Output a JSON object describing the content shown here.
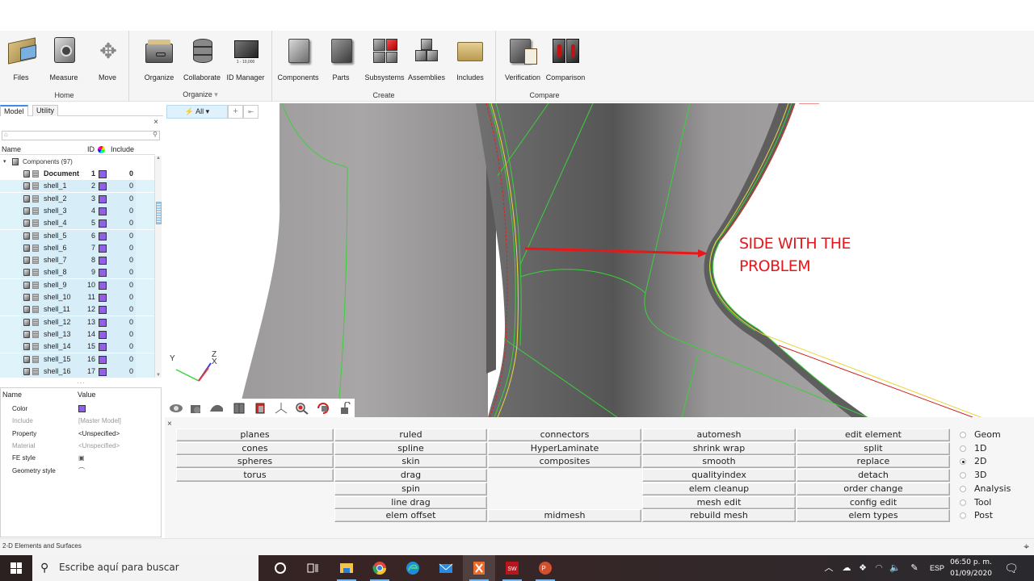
{
  "ribbon": {
    "groups": [
      {
        "title": "Home",
        "buttons": [
          "Files",
          "Measure",
          "Move"
        ]
      },
      {
        "title": "Organize",
        "buttons": [
          "Organize",
          "Collaborate",
          "ID Manager"
        ],
        "dropdown": "▾",
        "id_manager_caption": "1 - 10,000"
      },
      {
        "title": "Create",
        "buttons": [
          "Components",
          "Parts",
          "Subsystems",
          "Assemblies",
          "Includes"
        ]
      },
      {
        "title": "Compare",
        "buttons": [
          "Verification",
          "Comparison"
        ]
      }
    ]
  },
  "browser": {
    "tabs": [
      "Model",
      "Utility"
    ],
    "active_tab": "Model",
    "close": "×",
    "search_placeholder": "",
    "columns": {
      "name": "Name",
      "id": "ID",
      "include": "Include"
    },
    "root": {
      "label": "Components (97)",
      "expanded": true
    },
    "rows": [
      {
        "name": "Document",
        "id": "1",
        "include": "0",
        "bold": true
      },
      {
        "name": "shell_1",
        "id": "2",
        "include": "0"
      },
      {
        "name": "shell_2",
        "id": "3",
        "include": "0"
      },
      {
        "name": "shell_3",
        "id": "4",
        "include": "0"
      },
      {
        "name": "shell_4",
        "id": "5",
        "include": "0"
      },
      {
        "name": "shell_5",
        "id": "6",
        "include": "0"
      },
      {
        "name": "shell_6",
        "id": "7",
        "include": "0"
      },
      {
        "name": "shell_7",
        "id": "8",
        "include": "0"
      },
      {
        "name": "shell_8",
        "id": "9",
        "include": "0"
      },
      {
        "name": "shell_9",
        "id": "10",
        "include": "0"
      },
      {
        "name": "shell_10",
        "id": "11",
        "include": "0"
      },
      {
        "name": "shell_11",
        "id": "12",
        "include": "0"
      },
      {
        "name": "shell_12",
        "id": "13",
        "include": "0"
      },
      {
        "name": "shell_13",
        "id": "14",
        "include": "0"
      },
      {
        "name": "shell_14",
        "id": "15",
        "include": "0"
      },
      {
        "name": "shell_15",
        "id": "16",
        "include": "0"
      },
      {
        "name": "shell_16",
        "id": "17",
        "include": "0"
      }
    ],
    "component_color": "#9060e8"
  },
  "properties": {
    "header": {
      "name": "Name",
      "value": "Value"
    },
    "rows": [
      {
        "key": "Color",
        "value": "",
        "type": "color",
        "dim": false
      },
      {
        "key": "Include",
        "value": "[Master Model]",
        "dim": true
      },
      {
        "key": "Property",
        "value": "<Unspecified>",
        "dim": false
      },
      {
        "key": "Material",
        "value": "<Unspecified>",
        "dim": true
      },
      {
        "key": "FE style",
        "value": "",
        "type": "icon",
        "icon": "fe-style-icon",
        "dim": false
      },
      {
        "key": "Geometry style",
        "value": "",
        "type": "icon",
        "icon": "geometry-style-icon",
        "dim": false
      }
    ]
  },
  "filter": {
    "label": "⚡ All ▾",
    "add": "+",
    "collapse": "⇤"
  },
  "triad": {
    "x": "X",
    "y": "Y",
    "z": "Z"
  },
  "viewport": {
    "annotation_line1": "SIDE WITH THE",
    "annotation_line2": "PROBLEM",
    "annotation_color": "#e8171a"
  },
  "view_tools": [
    "eye-icon",
    "camera-icon",
    "surface-icon",
    "cube-icon",
    "component-icon",
    "triad-icon",
    "zoom-icon",
    "rotate-icon",
    "lock-icon"
  ],
  "panel": {
    "close": "×",
    "columns": [
      [
        "planes",
        "cones",
        "spheres",
        "torus",
        "",
        "",
        ""
      ],
      [
        "ruled",
        "spline",
        "skin",
        "drag",
        "spin",
        "line drag",
        "elem offset"
      ],
      [
        "connectors",
        "HyperLaminate",
        "composites",
        "",
        "",
        "",
        "midmesh"
      ],
      [
        "automesh",
        "shrink wrap",
        "smooth",
        "qualityindex",
        "elem cleanup",
        "mesh edit",
        "rebuild mesh"
      ],
      [
        "edit element",
        "split",
        "replace",
        "detach",
        "order change",
        "config edit",
        "elem types"
      ]
    ],
    "pages": [
      "Geom",
      "1D",
      "2D",
      "3D",
      "Analysis",
      "Tool",
      "Post"
    ],
    "selected_page": "2D"
  },
  "status": {
    "text": "2-D Elements and Surfaces"
  },
  "taskbar": {
    "search_placeholder": "Escribe aquí para buscar",
    "apps": [
      "cortana",
      "task-view",
      "file-explorer",
      "chrome",
      "edge",
      "mail",
      "hypermesh",
      "solidworks",
      "powerpoint"
    ],
    "language": "ESP",
    "time": "06:50 p. m.",
    "date": "01/09/2020"
  }
}
